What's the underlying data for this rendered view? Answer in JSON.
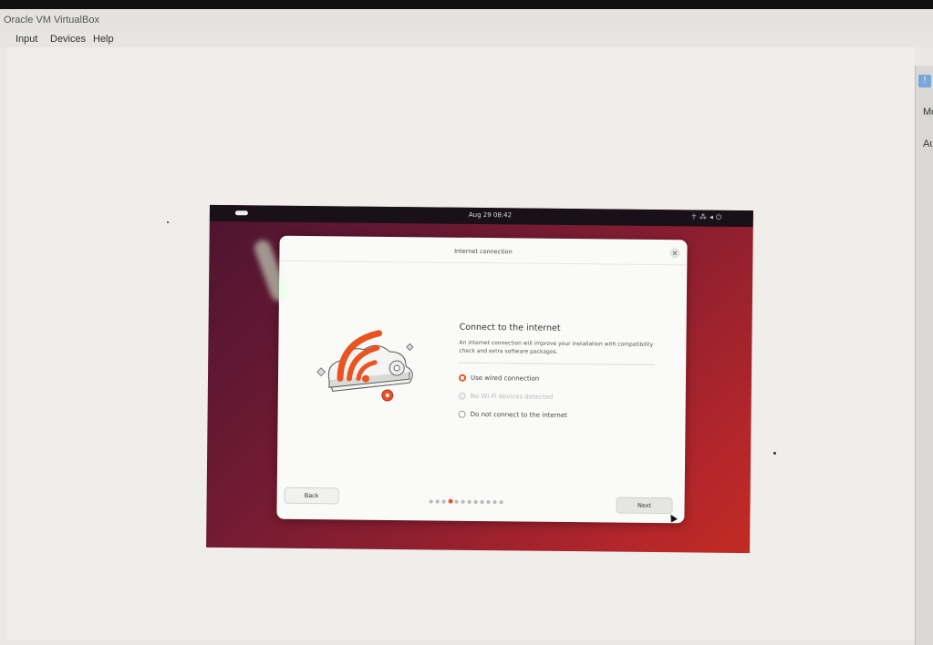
{
  "host": {
    "title": "Oracle VM VirtualBox",
    "menu": [
      "Input",
      "Devices",
      "Help"
    ],
    "right_panel": {
      "icon": "!",
      "items": [
        "Mo",
        "Au"
      ]
    }
  },
  "vm": {
    "topbar": {
      "clock": "Aug 29  08:42",
      "tray_icons": [
        "accessibility-icon",
        "network-icon",
        "volume-icon",
        "power-icon"
      ]
    },
    "dialog": {
      "title": "Internet connection",
      "heading": "Connect to the internet",
      "description": "An internet connection will improve your installation with compatibility check and extra software packages.",
      "options": [
        {
          "label": "Use wired connection",
          "selected": true,
          "disabled": false
        },
        {
          "label": "No Wi-Fi devices detected",
          "selected": false,
          "disabled": true
        },
        {
          "label": "Do not connect to the internet",
          "selected": false,
          "disabled": false
        }
      ],
      "back_label": "Back",
      "next_label": "Next",
      "progress": {
        "total_steps": 12,
        "current_step": 4
      }
    }
  },
  "colors": {
    "accent": "#e95420",
    "dialog_bg": "#fafaf9",
    "wallpaper_start": "#4c1430",
    "wallpaper_end": "#c22b22"
  }
}
